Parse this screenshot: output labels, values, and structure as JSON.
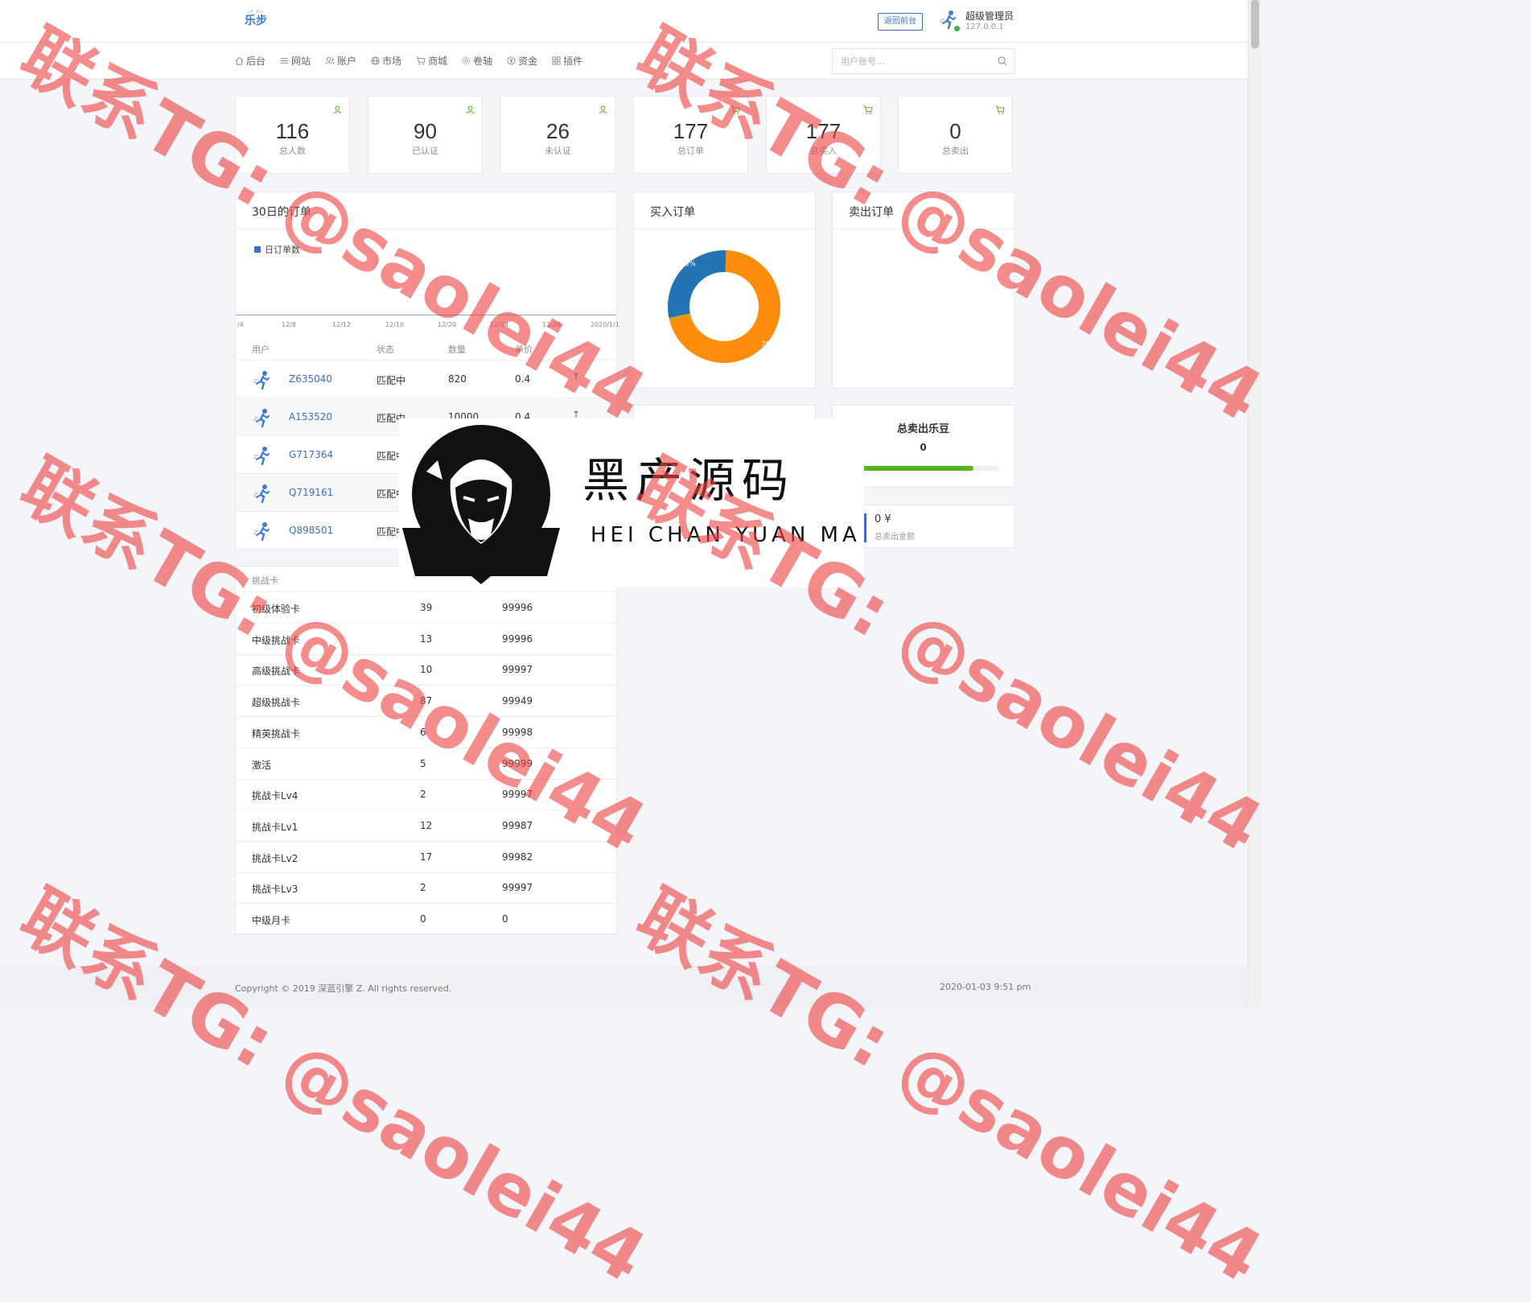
{
  "header": {
    "logo_small": "LE BU",
    "logo": "乐步",
    "front_button": "返回前台",
    "admin_name": "超级管理员",
    "admin_ip": "127.0.0.1"
  },
  "nav": {
    "items": [
      {
        "label": "后台",
        "icon": "home-icon"
      },
      {
        "label": "网站",
        "icon": "list-icon"
      },
      {
        "label": "账户",
        "icon": "users-icon"
      },
      {
        "label": "市场",
        "icon": "globe-icon"
      },
      {
        "label": "商城",
        "icon": "cart-icon"
      },
      {
        "label": "卷轴",
        "icon": "settings-icon"
      },
      {
        "label": "资金",
        "icon": "coin-icon"
      },
      {
        "label": "插件",
        "icon": "grid-icon"
      }
    ],
    "search_placeholder": "用户账号..."
  },
  "stats": [
    {
      "value": "116",
      "label": "总人数",
      "icon": "user-icon"
    },
    {
      "value": "90",
      "label": "已认证",
      "icon": "user-icon"
    },
    {
      "value": "26",
      "label": "未认证",
      "icon": "user-icon"
    },
    {
      "value": "177",
      "label": "总订单",
      "icon": "cart-icon"
    },
    {
      "value": "177",
      "label": "总买入",
      "icon": "cart-icon"
    },
    {
      "value": "0",
      "label": "总卖出",
      "icon": "cart-icon"
    }
  ],
  "orders_card": {
    "title": "30日的订单",
    "legend": "日订单数",
    "x_ticks": [
      "/4",
      "12/8",
      "12/12",
      "12/16",
      "12/20",
      "12/24",
      "12/28",
      "2020/1/1"
    ],
    "columns": [
      "用户",
      "状态",
      "数量",
      "单价"
    ],
    "rows": [
      {
        "user": "Z635040",
        "status": "匹配中",
        "qty": "820",
        "price": "0.4",
        "arrow": "↑"
      },
      {
        "user": "A153520",
        "status": "匹配中",
        "qty": "10000",
        "price": "0.4",
        "arrow": "↑"
      },
      {
        "user": "G717364",
        "status": "匹配中"
      },
      {
        "user": "Q719161",
        "status": "匹配中"
      },
      {
        "user": "Q898501",
        "status": "匹配中"
      }
    ]
  },
  "buy_card": {
    "title": "买入订单",
    "colors": {
      "blue": "#2274b5",
      "orange": "#ff8c0a",
      "gold": "#c8a800"
    }
  },
  "sell_card": {
    "title": "卖出订单"
  },
  "chart_data": [
    {
      "type": "line",
      "title": "30日的订单",
      "series": [
        {
          "name": "日订单数",
          "values": []
        }
      ],
      "x": [
        "/4",
        "12/8",
        "12/12",
        "12/16",
        "12/20",
        "12/24",
        "12/28",
        "2020/1/1"
      ]
    },
    {
      "type": "pie",
      "title": "买入订单",
      "labels": [
        "28.8%",
        "70.6%"
      ],
      "values": [
        28.8,
        70.6,
        0.6
      ]
    }
  ],
  "sell_beans": {
    "title": "总卖出乐豆",
    "value": "0",
    "progress": 0.82
  },
  "sell_amount": {
    "value": "0",
    "unit": "¥",
    "label": "总卖出金额"
  },
  "cards_table": {
    "header": "挑战卡",
    "rows": [
      {
        "name": "初级体验卡",
        "count": "39",
        "num": "99996"
      },
      {
        "name": "中级挑战卡",
        "count": "13",
        "num": "99996"
      },
      {
        "name": "高级挑战卡",
        "count": "10",
        "num": "99997"
      },
      {
        "name": "超级挑战卡",
        "count": "87",
        "num": "99949"
      },
      {
        "name": "精英挑战卡",
        "count": "6",
        "num": "99998"
      },
      {
        "name": "激活",
        "count": "5",
        "num": "99999"
      },
      {
        "name": "挑战卡Lv4",
        "count": "2",
        "num": "99997"
      },
      {
        "name": "挑战卡Lv1",
        "count": "12",
        "num": "99987"
      },
      {
        "name": "挑战卡Lv2",
        "count": "17",
        "num": "99982"
      },
      {
        "name": "挑战卡Lv3",
        "count": "2",
        "num": "99997"
      },
      {
        "name": "中级月卡",
        "count": "0",
        "num": "0"
      }
    ]
  },
  "footer": {
    "copyright": "Copyright © 2019 深蓝引擎 Z. All rights reserved.",
    "time": "2020-01-03 9:51 pm"
  },
  "overlay": {
    "brand": "黑产源码",
    "brand_en": "HEI CHAN YUAN MA"
  },
  "watermarks": [
    "联系TG: @saolei44"
  ]
}
